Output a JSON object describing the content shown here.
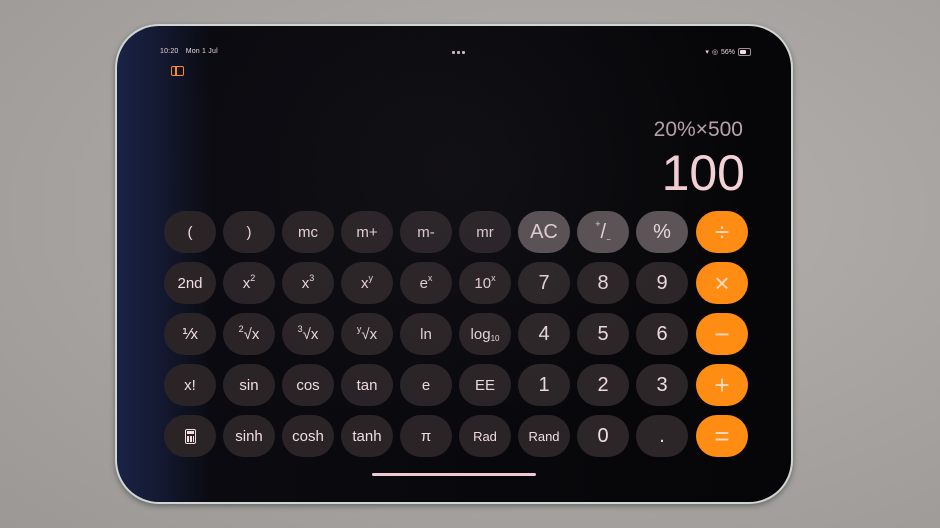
{
  "status_bar": {
    "time": "10:20",
    "date": "Mon 1 Jul",
    "battery_percent": "56%",
    "wifi_icon": "wifi-icon",
    "orientation_lock_icon": "orientation-lock-icon",
    "battery_level": 0.56
  },
  "toolbar": {
    "sidebar_icon": "sidebar-icon",
    "multitask_icon": "multitasking-dots-icon"
  },
  "display": {
    "expression": "20%×500",
    "result": "100"
  },
  "keys": {
    "row1": [
      "(",
      ")",
      "mc",
      "m+",
      "m-",
      "mr",
      "AC",
      "+/-",
      "%",
      "÷"
    ],
    "row2": [
      "2nd",
      "x²",
      "x³",
      "xʸ",
      "eˣ",
      "10ˣ",
      "7",
      "8",
      "9",
      "×"
    ],
    "row3": [
      "1/x",
      "²√x",
      "³√x",
      "ʸ√x",
      "ln",
      "log10",
      "4",
      "5",
      "6",
      "−"
    ],
    "row4": [
      "x!",
      "sin",
      "cos",
      "tan",
      "e",
      "EE",
      "1",
      "2",
      "3",
      "+"
    ],
    "row5": [
      "calculator-icon",
      "sinh",
      "cosh",
      "tanh",
      "π",
      "Rad",
      "Rand",
      "0",
      ".",
      "="
    ]
  },
  "colors": {
    "operator": "#ff8d14",
    "function_key": "#5e5558",
    "number_key": "#2c2628",
    "scientific_key": "#2a2427",
    "text": "#f2dde1"
  }
}
